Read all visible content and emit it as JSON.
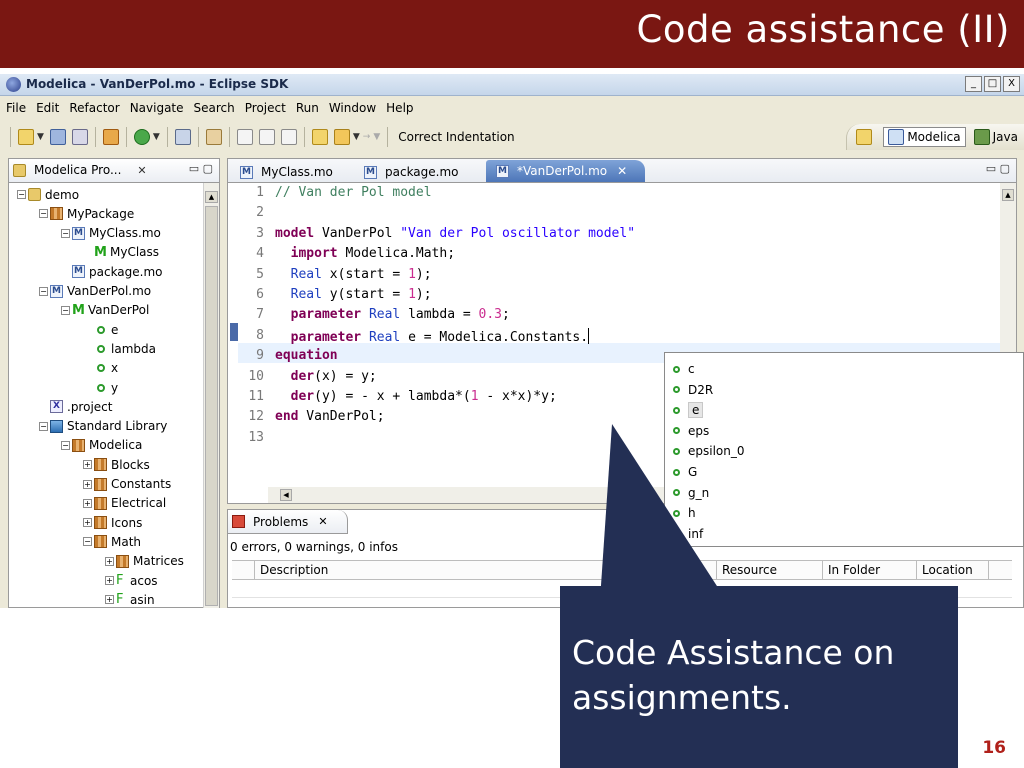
{
  "slide": {
    "title": "Code assistance (II)",
    "callout": "Code Assistance on assignments.",
    "page_number": "16"
  },
  "window": {
    "title": "Modelica - VanDerPol.mo - Eclipse SDK",
    "controls": [
      "_",
      "□",
      "X"
    ]
  },
  "menu": [
    "File",
    "Edit",
    "Refactor",
    "Navigate",
    "Search",
    "Project",
    "Run",
    "Window",
    "Help"
  ],
  "toolbar": {
    "correct_indentation": "Correct Indentation",
    "perspectives": [
      "Modelica",
      "Java"
    ]
  },
  "explorer": {
    "tab_label": "Modelica Pro...",
    "tree": [
      {
        "label": "demo",
        "icon": "project-icon",
        "depth": 0,
        "expander": "−"
      },
      {
        "label": "MyPackage",
        "icon": "package-icon",
        "depth": 1,
        "expander": "−"
      },
      {
        "label": "MyClass.mo",
        "icon": "mo-file-icon",
        "depth": 2,
        "expander": "−"
      },
      {
        "label": "MyClass",
        "icon": "class-icon",
        "depth": 3,
        "expander": ""
      },
      {
        "label": "package.mo",
        "icon": "mo-file-icon",
        "depth": 2,
        "expander": ""
      },
      {
        "label": "VanDerPol.mo",
        "icon": "mo-file-icon",
        "depth": 1,
        "expander": "−"
      },
      {
        "label": "VanDerPol",
        "icon": "class-icon",
        "depth": 2,
        "expander": "−"
      },
      {
        "label": "e",
        "icon": "variable-icon",
        "depth": 3,
        "expander": ""
      },
      {
        "label": "lambda",
        "icon": "variable-icon",
        "depth": 3,
        "expander": ""
      },
      {
        "label": "x",
        "icon": "variable-icon",
        "depth": 3,
        "expander": ""
      },
      {
        "label": "y",
        "icon": "variable-icon",
        "depth": 3,
        "expander": ""
      },
      {
        "label": ".project",
        "icon": "xml-file-icon",
        "depth": 1,
        "expander": ""
      },
      {
        "label": "Standard Library",
        "icon": "library-icon",
        "depth": 1,
        "expander": "−"
      },
      {
        "label": "Modelica",
        "icon": "package-icon",
        "depth": 2,
        "expander": "−"
      },
      {
        "label": "Blocks",
        "icon": "package-icon",
        "depth": 3,
        "expander": "+"
      },
      {
        "label": "Constants",
        "icon": "package-icon",
        "depth": 3,
        "expander": "+"
      },
      {
        "label": "Electrical",
        "icon": "package-icon",
        "depth": 3,
        "expander": "+"
      },
      {
        "label": "Icons",
        "icon": "package-icon",
        "depth": 3,
        "expander": "+"
      },
      {
        "label": "Math",
        "icon": "package-icon",
        "depth": 3,
        "expander": "−"
      },
      {
        "label": "Matrices",
        "icon": "package-icon",
        "depth": 4,
        "expander": "+"
      },
      {
        "label": "acos",
        "icon": "function-icon",
        "depth": 4,
        "expander": "+"
      },
      {
        "label": "asin",
        "icon": "function-icon",
        "depth": 4,
        "expander": "+"
      }
    ]
  },
  "editor": {
    "tabs": [
      {
        "label": "MyClass.mo",
        "active": false
      },
      {
        "label": "package.mo",
        "active": false
      },
      {
        "label": "*VanDerPol.mo",
        "active": true
      }
    ],
    "lines": [
      {
        "num": "1",
        "text": "// Van der Pol model"
      },
      {
        "num": "2",
        "text": ""
      },
      {
        "num": "3",
        "text": "model VanDerPol \"Van der Pol oscillator model\""
      },
      {
        "num": "4",
        "text": "  import Modelica.Math;"
      },
      {
        "num": "5",
        "text": "  Real x(start = 1);"
      },
      {
        "num": "6",
        "text": "  Real y(start = 1);"
      },
      {
        "num": "7",
        "text": "  parameter Real lambda = 0.3;"
      },
      {
        "num": "8",
        "text": "  parameter Real e = Modelica.Constants."
      },
      {
        "num": "9",
        "text": "equation"
      },
      {
        "num": "10",
        "text": "  der(x) = y;"
      },
      {
        "num": "11",
        "text": "  der(y) = - x + lambda*(1 - x*x)*y;"
      },
      {
        "num": "12",
        "text": "end VanDerPol;"
      },
      {
        "num": "13",
        "text": ""
      }
    ]
  },
  "completion": {
    "items": [
      "c",
      "D2R",
      "e",
      "eps",
      "epsilon_0",
      "G",
      "g_n",
      "h",
      "inf"
    ],
    "selected": "e"
  },
  "problems": {
    "tab_label": "Problems",
    "status": "0 errors, 0 warnings, 0 infos",
    "columns": [
      "Description",
      "Resource",
      "In Folder",
      "Location"
    ]
  },
  "colors": {
    "header_red": "#7a1712",
    "callout_navy": "#232f54",
    "keyword": "#7f0055",
    "comment": "#3f7f5f",
    "string": "#2a00ff"
  }
}
